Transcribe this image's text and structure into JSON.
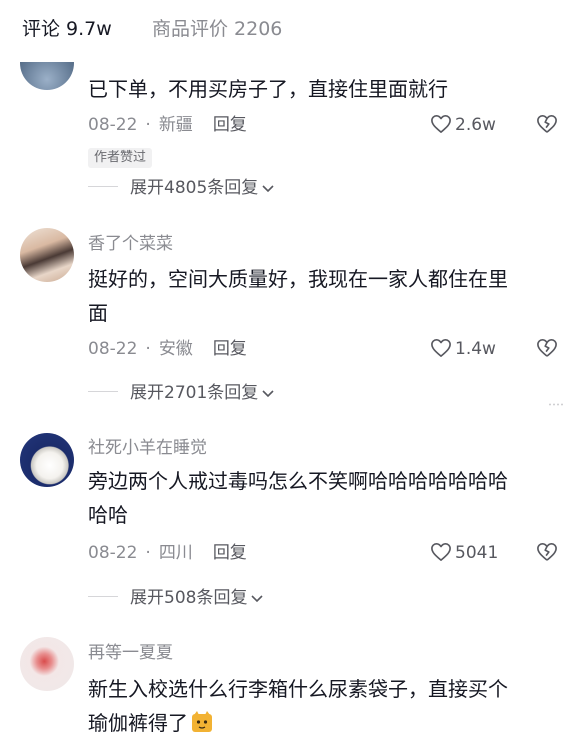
{
  "tabs": {
    "comments_label": "评论 9.7w",
    "product_reviews_label": "商品评价 2206"
  },
  "comments": [
    {
      "username": "",
      "text_lines": [
        "已下单，不用买房子了，直接住里面就行"
      ],
      "date": "08-22",
      "location": "新疆",
      "reply_label": "回复",
      "likes": "2.6w",
      "badge": "作者赞过",
      "expand_label": "展开4805条回复"
    },
    {
      "username": "香了个菜菜",
      "text_lines": [
        "挺好的，空间大质量好，我现在一家人都住在里",
        "面"
      ],
      "date": "08-22",
      "location": "安徽",
      "reply_label": "回复",
      "likes": "1.4w",
      "expand_label": "展开2701条回复"
    },
    {
      "username": "社死小羊在睡觉",
      "text_lines": [
        "旁边两个人戒过毒吗怎么不笑啊哈哈哈哈哈哈哈",
        "哈哈"
      ],
      "date": "08-22",
      "location": "四川",
      "reply_label": "回复",
      "likes": "5041",
      "expand_label": "展开508条回复"
    },
    {
      "username": "再等一夏夏",
      "text_lines": [
        "新生入校选什么行李箱什么尿素袋子，直接买个",
        "瑜伽裤得了"
      ]
    }
  ],
  "colors": {
    "primary_text": "#161823",
    "secondary_text": "#8a8b91",
    "badge_bg": "#f1f1f2"
  },
  "icons": {
    "like": "heart-outline-icon",
    "dislike": "broken-heart-icon",
    "expand": "chevron-down-icon",
    "emoji": "cat-face-emoji"
  }
}
